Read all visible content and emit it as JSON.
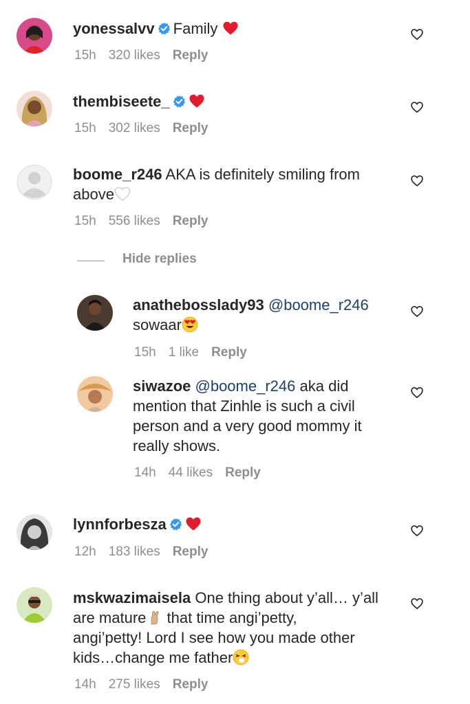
{
  "colors": {
    "text": "#262626",
    "secondary": "#8e8e8e",
    "mention": "#1d3f6b",
    "verified": "#3897f0",
    "heart_red": "#e31b2c"
  },
  "comments": [
    {
      "username": "yonessalvv",
      "verified": true,
      "text_lines": [
        "Family"
      ],
      "emoji_after": "red-heart",
      "time": "15h",
      "likes": "320 likes",
      "reply_label": "Reply"
    },
    {
      "username": "thembiseete_",
      "verified": true,
      "text_lines": [
        ""
      ],
      "emoji_after": "red-heart",
      "time": "15h",
      "likes": "302 likes",
      "reply_label": "Reply"
    },
    {
      "username": "boome_r246",
      "verified": false,
      "text_lines": [
        "AKA is definitely smiling from",
        "above"
      ],
      "emoji_after": "white-heart",
      "time": "15h",
      "likes": "556 likes",
      "reply_label": "Reply"
    },
    {
      "username": "lynnforbesza",
      "verified": true,
      "text_lines": [
        ""
      ],
      "emoji_after": "red-heart",
      "time": "12h",
      "likes": "183 likes",
      "reply_label": "Reply"
    },
    {
      "username": "mskwazimaisela",
      "verified": false,
      "text_lines": [
        "One thing about y’all… y’all",
        "are mature",
        "that time angi’petty,",
        "angi’petty! Lord I see how you made other",
        "kids…change me father"
      ],
      "emoji_after": "sneezing-face",
      "time": "14h",
      "likes": "275 likes",
      "reply_label": "Reply"
    }
  ],
  "hide_replies_label": "Hide replies",
  "replies": [
    {
      "username": "anathebosslady93",
      "mention": "@boome_r246",
      "text_lines": [
        "sowaar"
      ],
      "emoji_after": "heart-eyes",
      "time": "15h",
      "likes": "1 like",
      "reply_label": "Reply"
    },
    {
      "username": "siwazoe",
      "mention": "@boome_r246",
      "text_lines": [
        "aka did",
        "mention that Zinhle is such a civil",
        "person and a very good mommy it",
        "really shows."
      ],
      "time": "14h",
      "likes": "44 likes",
      "reply_label": "Reply"
    }
  ]
}
